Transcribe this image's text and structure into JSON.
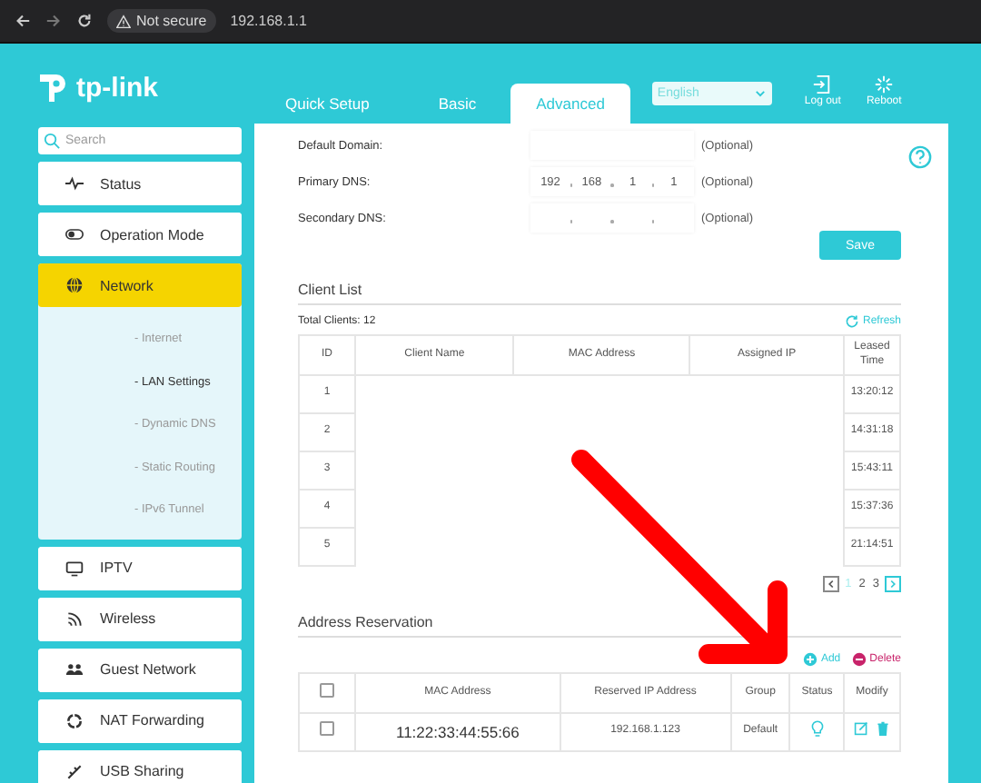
{
  "browser": {
    "security": "Not secure",
    "url": "192.168.1.1"
  },
  "header": {
    "logo": "tp-link",
    "tabs": [
      {
        "label": "Quick Setup",
        "selected": false
      },
      {
        "label": "Basic",
        "selected": false
      },
      {
        "label": "Advanced",
        "selected": true
      }
    ],
    "language": "English",
    "actions": [
      {
        "kind": "logout",
        "label": "Log out"
      },
      {
        "kind": "reboot",
        "label": "Reboot"
      }
    ]
  },
  "sidebar": {
    "search": {
      "placeholder": "Search"
    },
    "items": [
      {
        "kind": "status",
        "label": "Status",
        "selected": false
      },
      {
        "kind": "mode",
        "label": "Operation Mode",
        "selected": false
      },
      {
        "kind": "network",
        "label": "Network",
        "selected": true,
        "expanded": true,
        "children": [
          {
            "label": "- Internet",
            "selected": false
          },
          {
            "label": "- LAN Settings",
            "selected": true
          },
          {
            "label": "- Dynamic DNS",
            "selected": false
          },
          {
            "label": "- Static Routing",
            "selected": false
          },
          {
            "label": "- IPv6 Tunnel",
            "selected": false
          }
        ]
      },
      {
        "kind": "iptv",
        "label": "IPTV",
        "selected": false
      },
      {
        "kind": "wireless",
        "label": "Wireless",
        "selected": false
      },
      {
        "kind": "guest",
        "label": "Guest Network",
        "selected": false
      },
      {
        "kind": "nat",
        "label": "NAT Forwarding",
        "selected": false
      },
      {
        "kind": "usb",
        "label": "USB Sharing",
        "selected": false
      }
    ]
  },
  "dns": {
    "fields": [
      {
        "label": "Default Domain:",
        "kind": "text",
        "hint": "(Optional)"
      },
      {
        "label": "Primary DNS:",
        "kind": "ip",
        "octets": [
          "192",
          "168",
          "1",
          "1"
        ],
        "hint": "(Optional)"
      },
      {
        "label": "Secondary DNS:",
        "kind": "ip",
        "hint": "(Optional)"
      }
    ],
    "save": "Save"
  },
  "client_list": {
    "title": "Client List",
    "total": "Total Clients: 12",
    "refresh": "Refresh",
    "columns": [
      "ID",
      "Client Name",
      "MAC Address",
      "Assigned IP",
      "Leased Time"
    ],
    "rows": [
      {
        "id": "1",
        "time": "13:20:12"
      },
      {
        "id": "2",
        "time": "14:31:18"
      },
      {
        "id": "3",
        "time": "15:43:11"
      },
      {
        "id": "4",
        "time": "15:37:36"
      },
      {
        "id": "5",
        "time": "21:14:51"
      }
    ],
    "pages": [
      {
        "label": "1",
        "selected": true
      },
      {
        "label": "2",
        "selected": false
      },
      {
        "label": "3",
        "selected": false
      }
    ]
  },
  "reservation": {
    "title": "Address Reservation",
    "add": "Add",
    "delete": "Delete",
    "all_checked": false,
    "columns": [
      "MAC Address",
      "Reserved IP Address",
      "Group",
      "Status",
      "Modify"
    ],
    "rows": [
      {
        "checked": false,
        "mac": "11:22:33:44:55:66",
        "ip": "192.168.1.123",
        "group": "Default",
        "on": true
      }
    ]
  }
}
